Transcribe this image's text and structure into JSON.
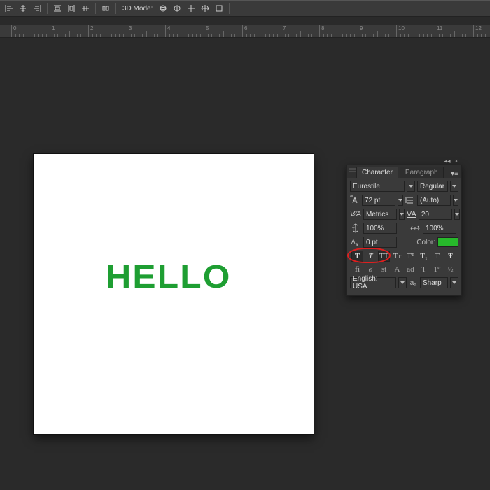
{
  "toolbar": {
    "mode_label": "3D Mode:"
  },
  "ruler": {
    "majors": [
      0,
      1,
      2,
      3,
      4,
      5,
      6,
      7,
      8,
      9,
      10,
      11,
      12
    ],
    "spacing": 55
  },
  "canvas": {
    "text": "HELLO",
    "text_color": "#1e9e32"
  },
  "panel": {
    "tabs": {
      "character": "Character",
      "paragraph": "Paragraph"
    },
    "font_family": "Eurostile",
    "font_style": "Regular",
    "font_size": "72 pt",
    "leading": "(Auto)",
    "kerning": "Metrics",
    "tracking": "20",
    "vscale": "100%",
    "hscale": "100%",
    "baseline": "0 pt",
    "color_label": "Color:",
    "color_value": "#27b92b",
    "typestyle_row1": [
      "T",
      "T",
      "TT",
      "Tᴛ",
      "Tᵀ",
      "T₁",
      "T",
      "Ŧ"
    ],
    "typestyle_row2": [
      "fi",
      "ø",
      "st",
      "A",
      "ad",
      "T",
      "1ˢᵗ",
      "½"
    ],
    "language": "English: USA",
    "aa_label": "aₐ",
    "antialias": "Sharp"
  }
}
